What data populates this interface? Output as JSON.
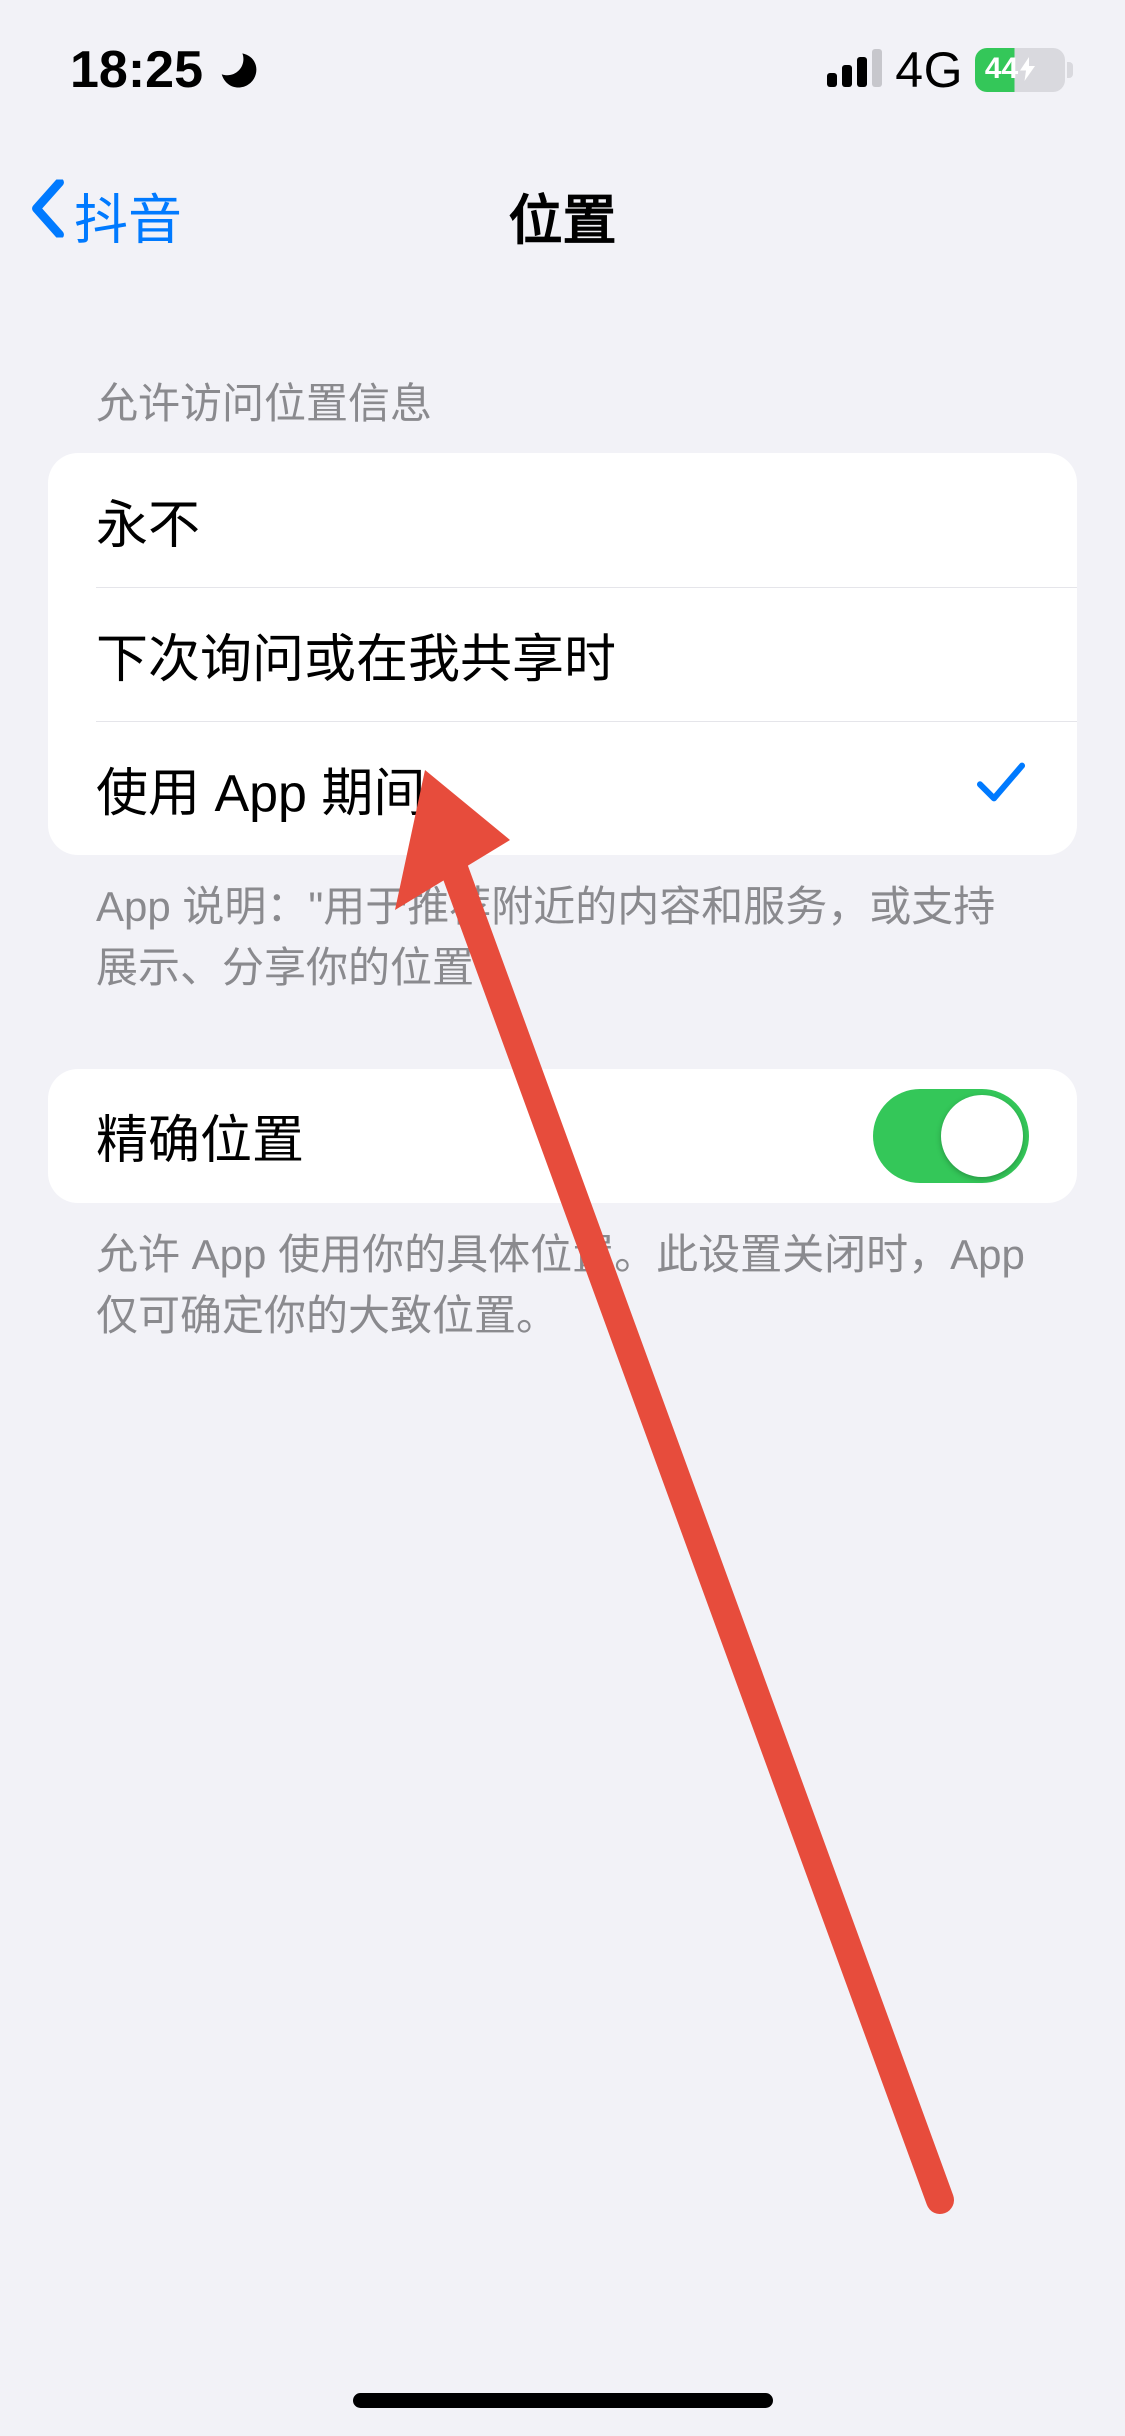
{
  "status": {
    "time": "18:25",
    "network_label": "4G",
    "battery_percent": "44"
  },
  "nav": {
    "back_label": "抖音",
    "title": "位置"
  },
  "location_access": {
    "header": "允许访问位置信息",
    "options": [
      {
        "label": "永不",
        "selected": false
      },
      {
        "label": "下次询问或在我共享时",
        "selected": false
      },
      {
        "label": "使用 App 期间",
        "selected": true
      }
    ],
    "footer": "App 说明：\"用于推荐附近的内容和服务，或支持展示、分享你的位置\""
  },
  "precise": {
    "label": "精确位置",
    "on": true,
    "footer": "允许 App 使用你的具体位置。此设置关闭时，App 仅可确定你的大致位置。"
  },
  "annotation": {
    "color": "#e74c3c"
  }
}
